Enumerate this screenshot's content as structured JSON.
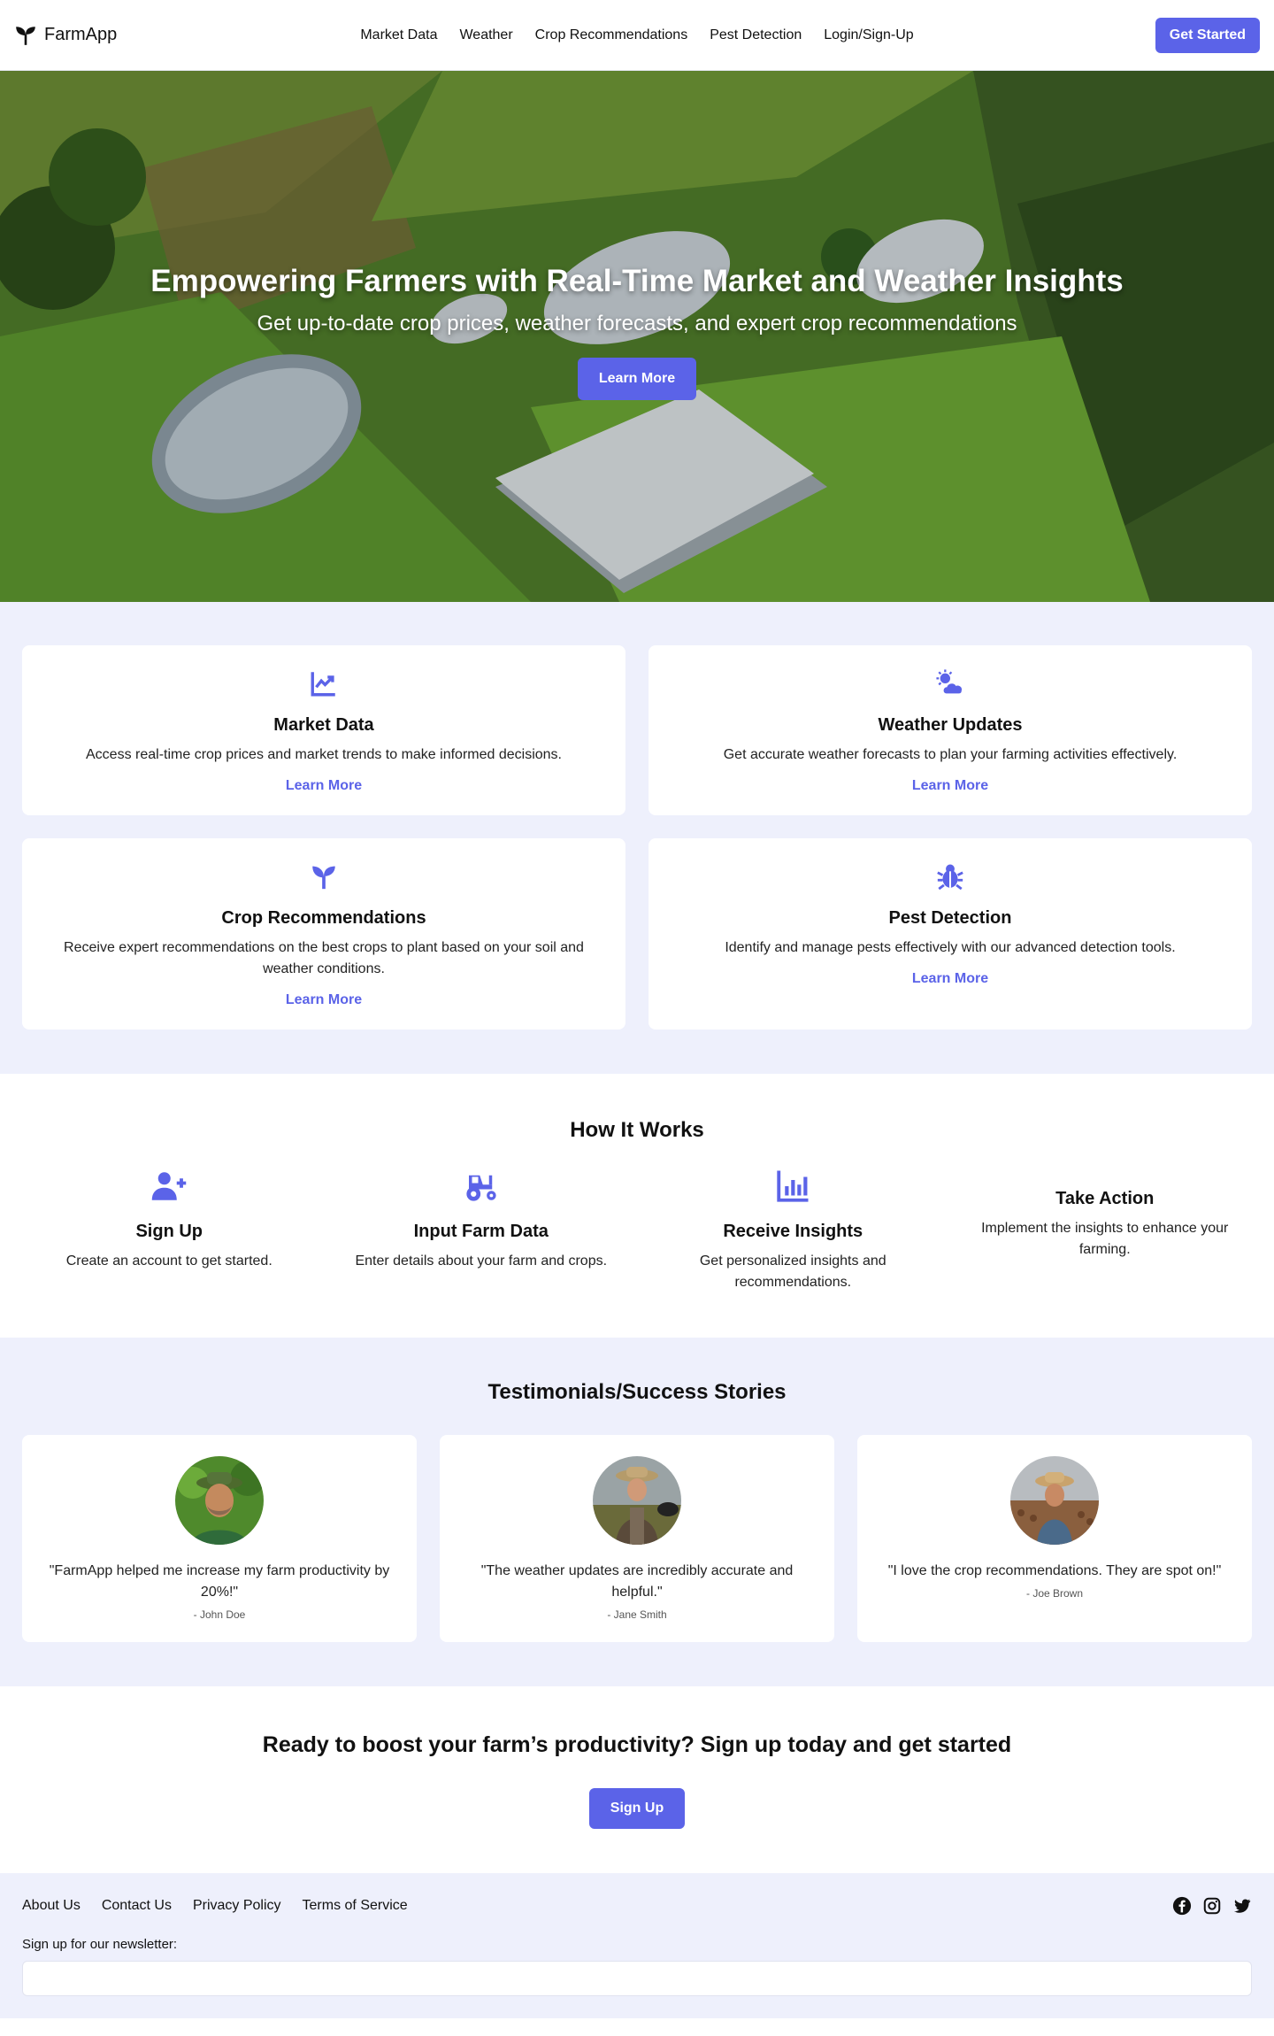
{
  "nav": {
    "brand": "FarmApp",
    "links": [
      "Market Data",
      "Weather",
      "Crop Recommendations",
      "Pest Detection",
      "Login/Sign-Up"
    ],
    "cta": "Get Started"
  },
  "hero": {
    "title": "Empowering Farmers with Real-Time Market and Weather Insights",
    "subtitle": "Get up-to-date crop prices, weather forecasts, and expert crop recommendations",
    "cta": "Learn More"
  },
  "features": [
    {
      "icon": "chart-line-icon",
      "title": "Market Data",
      "text": "Access real-time crop prices and market trends to make informed decisions.",
      "link": "Learn More"
    },
    {
      "icon": "cloud-sun-icon",
      "title": "Weather Updates",
      "text": "Get accurate weather forecasts to plan your farming activities effectively.",
      "link": "Learn More"
    },
    {
      "icon": "seedling-icon",
      "title": "Crop Recommendations",
      "text": "Receive expert recommendations on the best crops to plant based on your soil and weather conditions.",
      "link": "Learn More"
    },
    {
      "icon": "bug-icon",
      "title": "Pest Detection",
      "text": "Identify and manage pests effectively with our advanced detection tools.",
      "link": "Learn More"
    }
  ],
  "how": {
    "title": "How It Works",
    "steps": [
      {
        "icon": "user-plus-icon",
        "title": "Sign Up",
        "text": "Create an account to get started."
      },
      {
        "icon": "tractor-icon",
        "title": "Input Farm Data",
        "text": "Enter details about your farm and crops."
      },
      {
        "icon": "bar-chart-icon",
        "title": "Receive Insights",
        "text": "Get personalized insights and recommendations."
      },
      {
        "icon": "",
        "title": "Take Action",
        "text": "Implement the insights to enhance your farming."
      }
    ]
  },
  "testimonials": {
    "title": "Testimonials/Success Stories",
    "items": [
      {
        "quote": "\"FarmApp helped me increase my farm productivity by 20%!\"",
        "author": "- John Doe"
      },
      {
        "quote": "\"The weather updates are incredibly accurate and helpful.\"",
        "author": "- Jane Smith"
      },
      {
        "quote": "\"I love the crop recommendations. They are spot on!\"",
        "author": "- Joe Brown"
      }
    ]
  },
  "cta": {
    "title": "Ready to boost your farm’s productivity? Sign up today and get started",
    "button": "Sign Up"
  },
  "footer": {
    "links": [
      "About Us",
      "Contact Us",
      "Privacy Policy",
      "Terms of Service"
    ],
    "social": [
      "facebook-icon",
      "instagram-icon",
      "twitter-icon"
    ],
    "newsletter_label": "Sign up for our newsletter:",
    "newsletter_placeholder": ""
  },
  "colors": {
    "accent": "#5b63e8",
    "section_bg": "#eef0fc"
  }
}
